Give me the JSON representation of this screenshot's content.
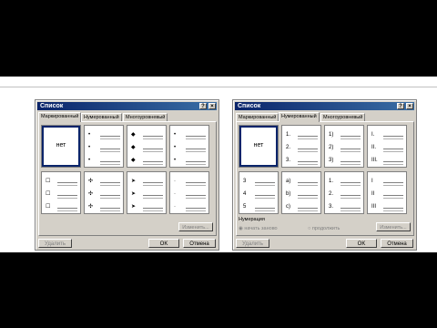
{
  "dialogs": [
    {
      "title": "Список",
      "tabs": [
        "Маркированный",
        "Нумерованный",
        "Многоуровневый"
      ],
      "active_tab": 0,
      "cells": [
        {
          "label": "нет",
          "marks": [],
          "selected": true
        },
        {
          "marks": [
            "•",
            "•",
            "•"
          ]
        },
        {
          "marks": [
            "◆",
            "◆",
            "◆"
          ]
        },
        {
          "marks": [
            "•",
            "•",
            "•"
          ]
        },
        {
          "marks": [
            "☐",
            "☐",
            "☐"
          ]
        },
        {
          "marks": [
            "✣",
            "✣",
            "✣"
          ]
        },
        {
          "marks": [
            "➤",
            "➤",
            "➤"
          ]
        },
        {
          "marks": [
            "·",
            "·",
            "·"
          ]
        }
      ],
      "change_button": "Изменить...",
      "buttons": {
        "delete": "Удалить",
        "ok": "OK",
        "cancel": "Отмена"
      }
    },
    {
      "title": "Список",
      "tabs": [
        "Маркированный",
        "Нумерованный",
        "Многоуровневый"
      ],
      "active_tab": 1,
      "cells": [
        {
          "label": "нет",
          "marks": [],
          "selected": true
        },
        {
          "marks": [
            "1.",
            "2.",
            "3."
          ]
        },
        {
          "marks": [
            "1)",
            "2)",
            "3)"
          ]
        },
        {
          "marks": [
            "I.",
            "II.",
            "III."
          ]
        },
        {
          "marks": [
            "3",
            "4",
            "5"
          ]
        },
        {
          "marks": [
            "a)",
            "b)",
            "c)"
          ]
        },
        {
          "marks": [
            "1.",
            "2.",
            "3."
          ]
        },
        {
          "marks": [
            "I",
            "II",
            "III"
          ]
        }
      ],
      "numbering_label": "Нумерация",
      "radio_restart": "начать заново",
      "radio_continue": "продолжить",
      "change_button": "Изменить...",
      "buttons": {
        "delete": "Удалить",
        "ok": "OK",
        "cancel": "Отмена"
      }
    }
  ],
  "title_help_icon": "question-icon",
  "title_close_icon": "close-icon"
}
